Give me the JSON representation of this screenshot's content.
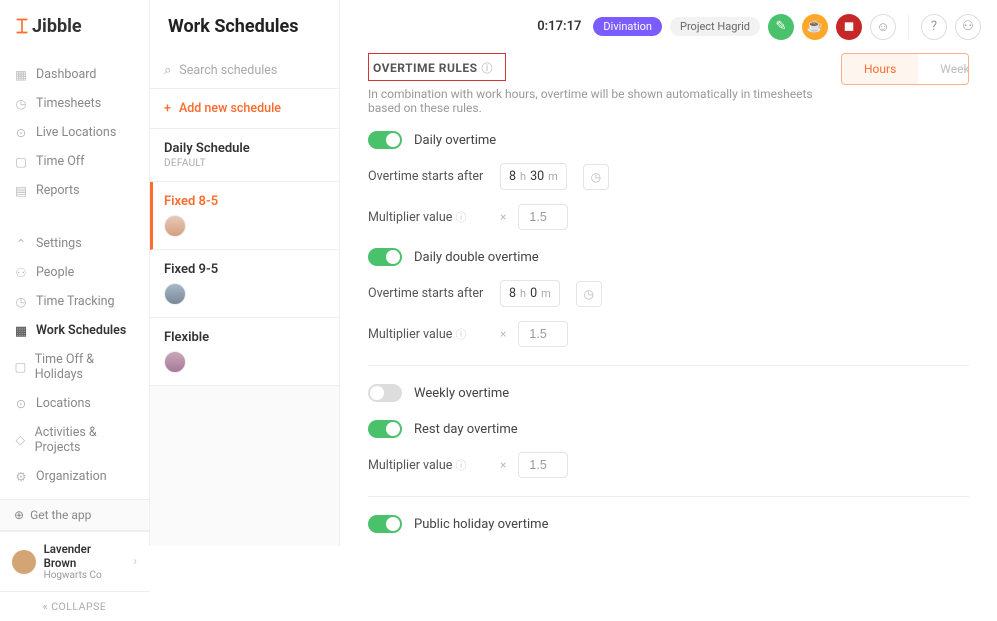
{
  "brand": "Jibble",
  "page_title": "Work Schedules",
  "nav": {
    "primary": [
      "Dashboard",
      "Timesheets",
      "Live Locations",
      "Time Off",
      "Reports"
    ],
    "secondary": [
      "Settings",
      "People",
      "Time Tracking",
      "Work Schedules",
      "Time Off & Holidays",
      "Locations",
      "Activities & Projects",
      "Organization"
    ],
    "active": "Work Schedules",
    "get_app": "Get the app",
    "collapse": "COLLAPSE"
  },
  "user": {
    "name": "Lavender Brown",
    "org": "Hogwarts Co"
  },
  "schedules": {
    "search_placeholder": "Search schedules",
    "add_label": "Add new schedule",
    "items": [
      {
        "title": "Daily Schedule",
        "sub": "DEFAULT"
      },
      {
        "title": "Fixed 8-5",
        "sub": ""
      },
      {
        "title": "Fixed 9-5",
        "sub": ""
      },
      {
        "title": "Flexible",
        "sub": ""
      }
    ],
    "active_index": 1
  },
  "topbar": {
    "timer": "0:17:17",
    "pill1": "Divination",
    "pill2": "Project Hagrid"
  },
  "section": {
    "title": "OVERTIME RULES",
    "desc": "In combination with work hours, overtime will be shown automatically in timesheets based on these rules.",
    "toggle": {
      "a": "Hours",
      "b": "Week"
    }
  },
  "rules": {
    "daily": {
      "label": "Daily overtime",
      "starts_label": "Overtime starts after",
      "h": "8",
      "m": "30",
      "mult_label": "Multiplier value",
      "mult": "1.5"
    },
    "daily_double": {
      "label": "Daily double overtime",
      "starts_label": "Overtime starts after",
      "h": "8",
      "m": "0",
      "mult_label": "Multiplier value",
      "mult": "1.5"
    },
    "weekly": {
      "label": "Weekly overtime"
    },
    "rest": {
      "label": "Rest day overtime",
      "mult_label": "Multiplier value",
      "mult": "1.5"
    },
    "holiday": {
      "label": "Public holiday overtime"
    }
  }
}
